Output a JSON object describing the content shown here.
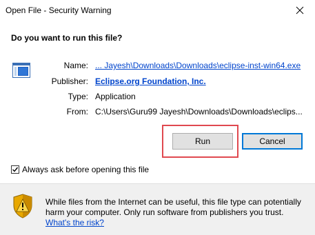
{
  "window": {
    "title": "Open File - Security Warning",
    "close_glyph": "✕"
  },
  "question": "Do you want to run this file?",
  "file_info": {
    "name_label": "Name:",
    "name_value": "... Jayesh\\Downloads\\Downloads\\eclipse-inst-win64.exe",
    "publisher_label": "Publisher:",
    "publisher_value": "Eclipse.org Foundation, Inc.",
    "type_label": "Type:",
    "type_value": "Application",
    "from_label": "From:",
    "from_value": "C:\\Users\\Guru99 Jayesh\\Downloads\\Downloads\\eclips..."
  },
  "buttons": {
    "run_label": "Run",
    "cancel_label": "Cancel"
  },
  "checkbox": {
    "label": "Always ask before opening this file",
    "checked": true
  },
  "warning": {
    "text": "While files from the Internet can be useful, this file type can potentially harm your computer. Only run software from publishers you trust.",
    "link_label": "What's the risk?"
  },
  "colors": {
    "link": "#0044cc",
    "highlight": "#e0484f",
    "focus_border": "#0078d7",
    "footer_bg": "#f0f0f0"
  },
  "icons": {
    "file": "application-file-icon",
    "shield": "warning-shield-icon",
    "close": "close-icon"
  }
}
